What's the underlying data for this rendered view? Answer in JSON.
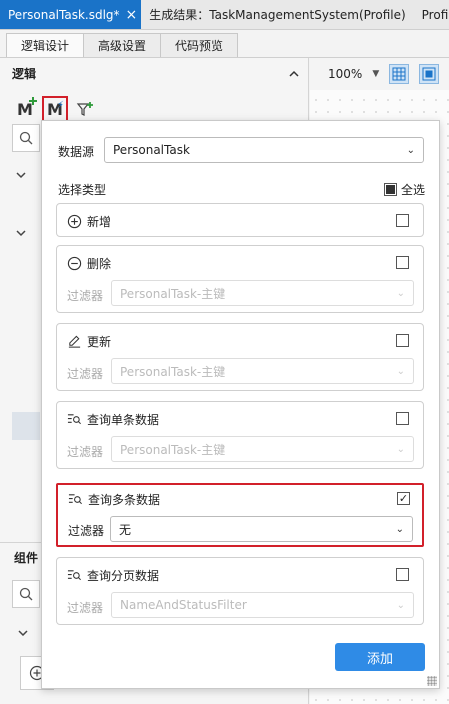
{
  "doc_tabs": [
    {
      "label": "PersonalTask.sdlg*",
      "active": true
    },
    {
      "label": "生成结果：TaskManagementSystem(Profile)",
      "active": false
    },
    {
      "label": "Profile-T",
      "active": false
    }
  ],
  "sub_tabs": [
    "逻辑设计",
    "高级设置",
    "代码预览"
  ],
  "left_panel": {
    "title": "逻辑",
    "section2_title": "组件",
    "toolbar": [
      "add-model-icon",
      "model-action-icon",
      "filter-add-icon"
    ]
  },
  "canvas": {
    "zoom": "100%"
  },
  "dialog": {
    "datasource_label": "数据源",
    "datasource_value": "PersonalTask",
    "type_heading": "选择类型",
    "select_all_label": "全选",
    "select_all_checked": true,
    "filter_label": "过滤器",
    "cards": [
      {
        "name": "新增",
        "icon": "add-circle-icon",
        "checked": false,
        "has_filter": false
      },
      {
        "name": "删除",
        "icon": "minus-circle-icon",
        "checked": false,
        "has_filter": true,
        "filter_value": "PersonalTask-主键",
        "filter_enabled": false
      },
      {
        "name": "更新",
        "icon": "edit-icon",
        "checked": false,
        "has_filter": true,
        "filter_value": "PersonalTask-主键",
        "filter_enabled": false
      },
      {
        "name": "查询单条数据",
        "icon": "query-icon",
        "checked": false,
        "has_filter": true,
        "filter_value": "PersonalTask-主键",
        "filter_enabled": false
      },
      {
        "name": "查询多条数据",
        "icon": "query-icon",
        "checked": true,
        "has_filter": true,
        "filter_value": "无",
        "filter_enabled": true,
        "highlighted": true
      },
      {
        "name": "查询分页数据",
        "icon": "query-icon",
        "checked": false,
        "has_filter": true,
        "filter_value": "NameAndStatusFilter",
        "filter_enabled": false
      }
    ],
    "submit_label": "添加"
  },
  "colors": {
    "accent": "#2f8be6",
    "tab_active": "#1a73c8",
    "highlight": "#d2202a"
  }
}
